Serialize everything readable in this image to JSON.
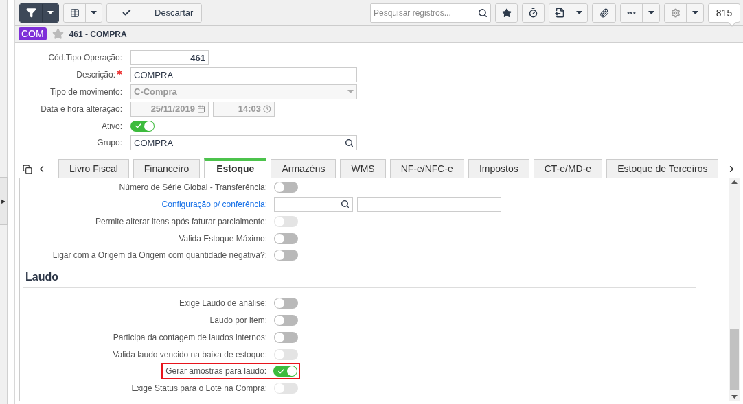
{
  "sidebar_toggle": {
    "glyph": "▶"
  },
  "toolbar": {
    "discard_label": "Descartar",
    "search": {
      "placeholder": "Pesquisar registros..."
    },
    "record_count": "815"
  },
  "record": {
    "badge": "COM",
    "title": "461 - COMPRA",
    "starred": false
  },
  "form": [
    {
      "kind": "number",
      "label": "Cód.Tipo Operação:",
      "value": "461",
      "required": false,
      "disabled": false
    },
    {
      "kind": "text",
      "label": "Descrição:",
      "value": "COMPRA",
      "required": true,
      "disabled": false
    },
    {
      "kind": "select",
      "label": "Tipo de movimento:",
      "value": "C-Compra",
      "required": false,
      "disabled": true
    },
    {
      "kind": "datetime",
      "label": "Data e hora alteração:",
      "date": "25/11/2019",
      "time": "14:03",
      "required": false,
      "disabled": true
    },
    {
      "kind": "toggle",
      "label": "Ativo:",
      "on": true,
      "required": false,
      "disabled": false
    },
    {
      "kind": "lookup",
      "label": "Grupo:",
      "value": "COMPRA",
      "required": false,
      "disabled": false
    }
  ],
  "tabs": [
    {
      "label": "Livro Fiscal",
      "selected": false
    },
    {
      "label": "Financeiro",
      "selected": false
    },
    {
      "label": "Estoque",
      "selected": true
    },
    {
      "label": "Armazéns",
      "selected": false
    },
    {
      "label": "WMS",
      "selected": false
    },
    {
      "label": "NF-e/NFC-e",
      "selected": false
    },
    {
      "label": "Impostos",
      "selected": false
    },
    {
      "label": "CT-e/MD-e",
      "selected": false
    },
    {
      "label": "Estoque de Terceiros",
      "selected": false
    }
  ],
  "settings": [
    {
      "kind": "toggle",
      "label": "Número de Série Global - Transferência:",
      "on": false,
      "disabled": false,
      "highlighted": false
    },
    {
      "kind": "lookup",
      "label": "Configuração p/ conferência:",
      "link": true
    },
    {
      "kind": "toggle",
      "label": "Permite alterar itens após faturar parcialmente:",
      "on": false,
      "disabled": true,
      "highlighted": false
    },
    {
      "kind": "toggle",
      "label": "Valida Estoque Máximo:",
      "on": false,
      "disabled": false,
      "highlighted": false
    },
    {
      "kind": "toggle",
      "label": "Ligar com a Origem da Origem com quantidade negativa?:",
      "on": false,
      "disabled": false,
      "highlighted": false
    },
    {
      "kind": "section",
      "title": "Laudo"
    },
    {
      "kind": "toggle",
      "label": "Exige Laudo de análise:",
      "on": false,
      "disabled": false,
      "highlighted": false
    },
    {
      "kind": "toggle",
      "label": "Laudo por item:",
      "on": false,
      "disabled": false,
      "highlighted": false
    },
    {
      "kind": "toggle",
      "label": "Participa da contagem de laudos internos:",
      "on": false,
      "disabled": false,
      "highlighted": false
    },
    {
      "kind": "toggle",
      "label": "Valida laudo vencido na baixa de estoque:",
      "on": false,
      "disabled": true,
      "highlighted": false
    },
    {
      "kind": "toggle",
      "label": "Gerar amostras para laudo:",
      "on": true,
      "disabled": false,
      "highlighted": true
    },
    {
      "kind": "toggle",
      "label": "Exige Status para o Lote na Compra:",
      "on": false,
      "disabled": true,
      "highlighted": false
    }
  ]
}
